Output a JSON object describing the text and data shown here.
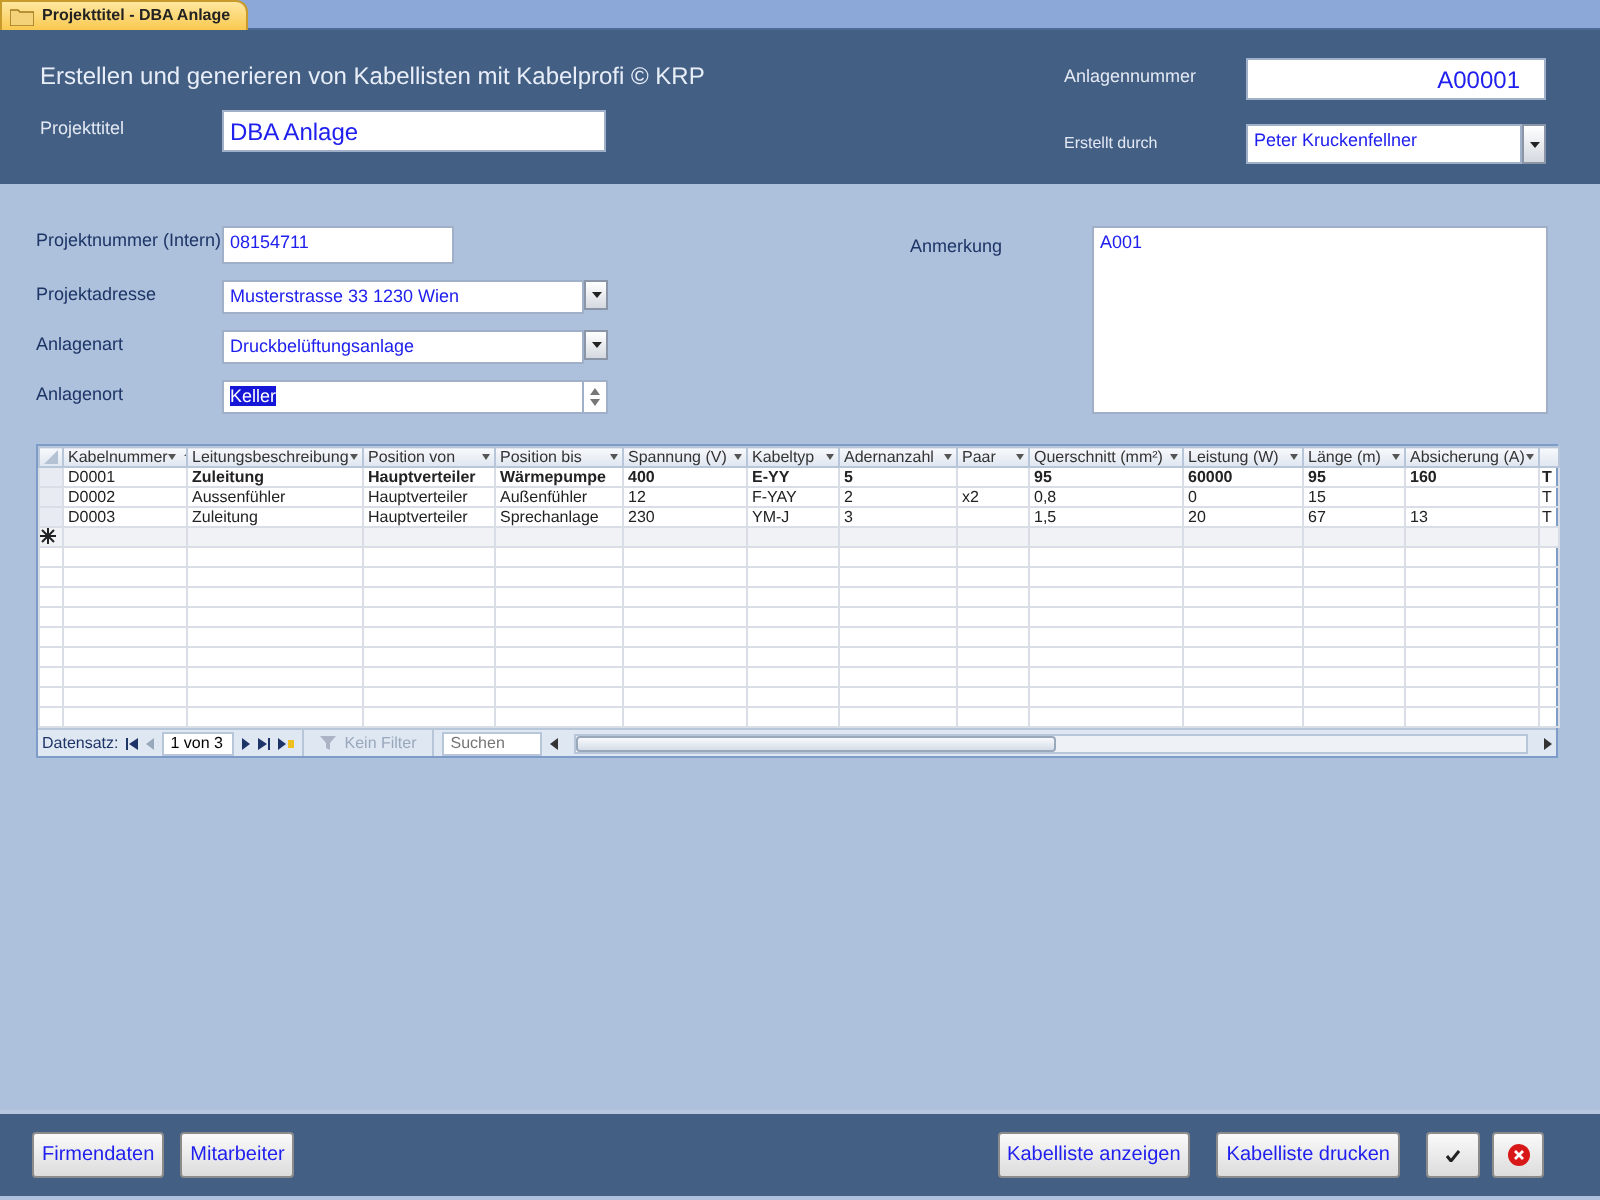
{
  "tab": {
    "title": "Projekttitel - DBA Anlage",
    "selected": true
  },
  "header": {
    "heading": "Erstellen und generieren von Kabellisten mit Kabelprofi © KRP",
    "projekttitel": {
      "label": "Projekttitel",
      "value": "DBA Anlage"
    },
    "anlagennummer": {
      "label": "Anlagennummer",
      "value": "A00001"
    },
    "erstellt_durch": {
      "label": "Erstellt durch",
      "value": "Peter Kruckenfellner"
    }
  },
  "form": {
    "fields": [
      {
        "label": "Projektnummer (Intern)",
        "value": "08154711",
        "kind": "text",
        "highlighted": false
      },
      {
        "label": "Projektadresse",
        "value": "Musterstrasse 33 1230 Wien",
        "kind": "combo",
        "highlighted": false
      },
      {
        "label": "Anlagenart",
        "value": "Druckbelüftungsanlage",
        "kind": "combo",
        "highlighted": false
      },
      {
        "label": "Anlagenort",
        "value": "Keller",
        "kind": "spin",
        "highlighted": true
      }
    ],
    "anmerkung": {
      "label": "Anmerkung",
      "value": "A001"
    }
  },
  "table": {
    "columns": [
      {
        "label": "Kabelnummer",
        "sorted": true
      },
      {
        "label": "Leitungsbeschreibung",
        "sorted": false
      },
      {
        "label": "Position von",
        "sorted": false
      },
      {
        "label": "Position bis",
        "sorted": false
      },
      {
        "label": "Spannung (V)",
        "sorted": false
      },
      {
        "label": "Kabeltyp",
        "sorted": false
      },
      {
        "label": "Adernanzahl",
        "sorted": false
      },
      {
        "label": "Paar",
        "sorted": false
      },
      {
        "label": "Querschnitt (mm²)",
        "sorted": false
      },
      {
        "label": "Leistung (W)",
        "sorted": false
      },
      {
        "label": "Länge (m)",
        "sorted": false
      },
      {
        "label": "Absicherung (A)",
        "sorted": false
      }
    ],
    "rows": [
      {
        "selected": true,
        "cells": [
          "D0001",
          "Zuleitung",
          "Hauptverteiler",
          "Wärmepumpe",
          "400",
          "E-YY",
          "5",
          "",
          "95",
          "60000",
          "95",
          "160",
          "T"
        ]
      },
      {
        "selected": false,
        "cells": [
          "D0002",
          "Aussenfühler",
          "Hauptverteiler",
          "Außenfühler",
          "12",
          "F-YAY",
          "2",
          "x2",
          "0,8",
          "0",
          "15",
          "",
          "T"
        ]
      },
      {
        "selected": false,
        "cells": [
          "D0003",
          "Zuleitung",
          "Hauptverteiler",
          "Sprechanlage",
          "230",
          "YM-J",
          "3",
          "",
          "1,5",
          "20",
          "67",
          "13",
          "T"
        ]
      }
    ],
    "navigator": {
      "label": "Datensatz:",
      "record": "1 von 3",
      "filter": "Kein Filter",
      "filter_enabled": false,
      "search_placeholder": "Suchen"
    }
  },
  "footer": {
    "left_buttons": [
      {
        "label": "Firmendaten"
      },
      {
        "label": "Mitarbeiter"
      }
    ],
    "right_buttons": [
      {
        "kind": "text",
        "label": "Kabelliste anzeigen"
      },
      {
        "kind": "text",
        "label": "Kabelliste drucken"
      },
      {
        "kind": "ok"
      },
      {
        "kind": "cancel"
      }
    ]
  }
}
